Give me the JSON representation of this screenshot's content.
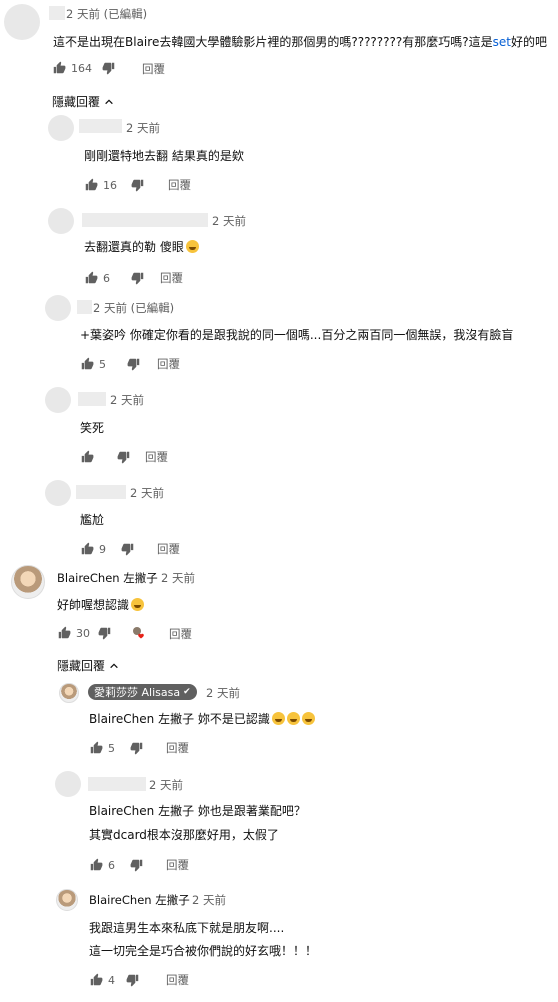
{
  "reply_label": "回覆",
  "hide_replies_label": "隱藏回覆",
  "comment_main": {
    "time": "2 天前 (已編輯)",
    "text_a": "這不是出現在",
    "text_b": "Blaire",
    "text_c": "去韓國大學體驗影片裡的那個男的嗎????????有那麼巧嗎?這是",
    "text_d": "set",
    "text_e": "好的吧",
    "likes": "164"
  },
  "replies_1": [
    {
      "time": "2 天前",
      "text": "剛剛還特地去翻 結果真的是欸",
      "likes": "16"
    },
    {
      "time": "2 天前",
      "text": "去翻還真的勒 傻眼",
      "likes": "6"
    },
    {
      "time": "2 天前 (已編輯)",
      "text": "+葉姿吟 你確定你看的是跟我說的同一個嗎...百分之兩百同一個無誤，我沒有臉盲",
      "likes": "5"
    },
    {
      "time": "2 天前",
      "text": "笑死",
      "likes": ""
    },
    {
      "time": "2 天前",
      "text": "尷尬",
      "likes": "9"
    }
  ],
  "comment_blaire": {
    "author": "BlaireChen 左撇子",
    "time": "2 天前",
    "text": "好帥喔想認識",
    "likes": "30"
  },
  "replies_2": {
    "alisasa": {
      "author": "愛莉莎莎 Alisasa",
      "check": "✔",
      "time": "2 天前",
      "text": "BlaireChen 左撇子 妳不是已認識",
      "likes": "5"
    },
    "anon": {
      "time": "2 天前",
      "line1": "BlaireChen 左撇子 妳也是跟著業配吧？",
      "line2": "其實dcard根本沒那麼好用，太假了",
      "likes": "6"
    },
    "blaire_reply": {
      "author": "BlaireChen 左撇子",
      "time": "2 天前",
      "line1": "我跟這男生本來私底下就是朋友啊....",
      "line2": "這一切完全是巧合被你們說的好玄哦！！！",
      "likes": "4"
    }
  }
}
